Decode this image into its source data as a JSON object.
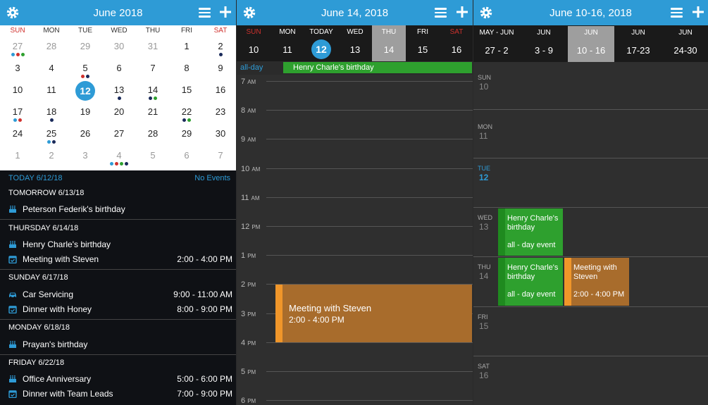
{
  "month_view": {
    "title": "June 2018",
    "weekdays": [
      "SUN",
      "MON",
      "TUE",
      "WED",
      "THU",
      "FRI",
      "SAT"
    ],
    "weeks": [
      [
        "27",
        "28",
        "29",
        "30",
        "31",
        "1",
        "2"
      ],
      [
        "3",
        "4",
        "5",
        "6",
        "7",
        "8",
        "9"
      ],
      [
        "10",
        "11",
        "12",
        "13",
        "14",
        "15",
        "16"
      ],
      [
        "17",
        "18",
        "19",
        "20",
        "21",
        "22",
        "23"
      ],
      [
        "24",
        "25",
        "26",
        "27",
        "28",
        "29",
        "30"
      ],
      [
        "1",
        "2",
        "3",
        "4",
        "5",
        "6",
        "7"
      ]
    ],
    "today": "12"
  },
  "agenda": {
    "today_label": "TODAY 6/12/18",
    "no_events": "No Events",
    "sections": [
      {
        "header": "TOMORROW 6/13/18",
        "items": [
          {
            "icon": "cake-icon",
            "title": "Peterson Federik's birthday",
            "time": ""
          }
        ]
      },
      {
        "header": "THURSDAY 6/14/18",
        "items": [
          {
            "icon": "cake-icon",
            "title": "Henry Charle's birthday",
            "time": ""
          },
          {
            "icon": "calendar-check-icon",
            "title": "Meeting with Steven",
            "time": "2:00 - 4:00 PM"
          }
        ]
      },
      {
        "header": "SUNDAY 6/17/18",
        "items": [
          {
            "icon": "car-icon",
            "title": "Car Servicing",
            "time": "9:00 - 11:00 AM"
          },
          {
            "icon": "calendar-check-icon",
            "title": "Dinner with Honey",
            "time": "8:00 - 9:00 PM"
          }
        ]
      },
      {
        "header": "MONDAY 6/18/18",
        "items": [
          {
            "icon": "cake-icon",
            "title": "Prayan's birthday",
            "time": ""
          }
        ]
      },
      {
        "header": "FRIDAY 6/22/18",
        "items": [
          {
            "icon": "cake-icon",
            "title": "Office Anniversary",
            "time": "5:00 - 6:00 PM"
          },
          {
            "icon": "calendar-check-icon",
            "title": "Dinner with Team Leads",
            "time": "7:00 - 9:00 PM"
          }
        ]
      }
    ]
  },
  "day_view": {
    "title": "June 14, 2018",
    "days": [
      {
        "name": "SUN",
        "num": "10"
      },
      {
        "name": "MON",
        "num": "11"
      },
      {
        "name": "TODAY",
        "num": "12"
      },
      {
        "name": "WED",
        "num": "13"
      },
      {
        "name": "THU",
        "num": "14"
      },
      {
        "name": "FRI",
        "num": "15"
      },
      {
        "name": "SAT",
        "num": "16"
      }
    ],
    "allday_label": "all-day",
    "allday_event": "Henry Charle's birthday",
    "hours": [
      {
        "h": "7",
        "ap": "AM"
      },
      {
        "h": "8",
        "ap": "AM"
      },
      {
        "h": "9",
        "ap": "AM"
      },
      {
        "h": "10",
        "ap": "AM"
      },
      {
        "h": "11",
        "ap": "AM"
      },
      {
        "h": "12",
        "ap": "PM"
      },
      {
        "h": "1",
        "ap": "PM"
      },
      {
        "h": "2",
        "ap": "PM"
      },
      {
        "h": "3",
        "ap": "PM"
      },
      {
        "h": "4",
        "ap": "PM"
      },
      {
        "h": "5",
        "ap": "PM"
      },
      {
        "h": "6",
        "ap": "PM"
      }
    ],
    "event": {
      "title": "Meeting with Steven",
      "time": "2:00 - 4:00 PM"
    }
  },
  "week_view": {
    "title": "June 10-16, 2018",
    "weeks": [
      {
        "month": "MAY - JUN",
        "range": "27 - 2"
      },
      {
        "month": "JUN",
        "range": "3 - 9"
      },
      {
        "month": "JUN",
        "range": "10 - 16"
      },
      {
        "month": "JUN",
        "range": "17-23"
      },
      {
        "month": "JUN",
        "range": "24-30"
      }
    ],
    "days": [
      {
        "name": "SUN",
        "num": "10"
      },
      {
        "name": "MON",
        "num": "11"
      },
      {
        "name": "TUE",
        "num": "12"
      },
      {
        "name": "WED",
        "num": "13"
      },
      {
        "name": "THU",
        "num": "14"
      },
      {
        "name": "FRI",
        "num": "15"
      },
      {
        "name": "SAT",
        "num": "16"
      }
    ],
    "events": {
      "wed_birthday": {
        "title": "Henry Charle's birthday",
        "sub": "all - day event"
      },
      "thu_birthday": {
        "title": "Henry Charle's birthday",
        "sub": "all - day event"
      },
      "thu_meeting": {
        "title": "Meeting with Steven",
        "time": "2:00 - 4:00 PM"
      }
    }
  },
  "colors": {
    "accent": "#2e9bd6",
    "weekend": "#d0312d",
    "green": "#2ea02e",
    "orange": "#a86c2c",
    "orange_bar": "#f0962a",
    "selected": "#9e9e9e"
  }
}
